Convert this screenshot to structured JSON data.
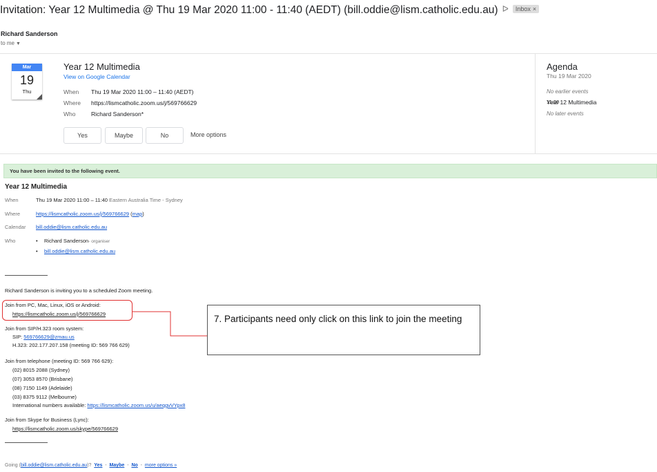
{
  "header": {
    "subject": "Invitation: Year 12 Multimedia @ Thu 19 Mar 2020 11:00 - 11:40 (AEDT) (bill.oddie@lism.catholic.edu.au)",
    "importance_icon": "important-marker-icon",
    "label_badge": "Inbox",
    "label_remove": "×",
    "sender": "Richard Sanderson",
    "to": "to me"
  },
  "card": {
    "calendar_icon": {
      "month": "Mar",
      "day": "19",
      "weekday": "Thu"
    },
    "title": "Year 12 Multimedia",
    "gcal_link": "View on Google Calendar",
    "when_label": "When",
    "when_value": "Thu 19 Mar 2020 11:00 – 11:40 (AEDT)",
    "where_label": "Where",
    "where_value": "https://lismcatholic.zoom.us/j/569766629",
    "who_label": "Who",
    "who_value": "Richard Sanderson*",
    "rsvp": {
      "yes": "Yes",
      "maybe": "Maybe",
      "no": "No",
      "more": "More options"
    }
  },
  "agenda": {
    "title": "Agenda",
    "date": "Thu 19 Mar 2020",
    "no_earlier": "No earlier events",
    "item_time": "11:00",
    "item_title": "Year 12 Multimedia",
    "no_later": "No later events"
  },
  "body": {
    "banner": "You have been invited to the following event.",
    "title": "Year 12 Multimedia",
    "when_label": "When",
    "when_value": "Thu 19 Mar 2020 11:00 – 11:40",
    "when_tz": "Eastern Australia Time - Sydney",
    "where_label": "Where",
    "where_link": "https://lismcatholic.zoom.us/j/569766629",
    "map_open": "(",
    "map_link": "map",
    "map_close": ")",
    "calendar_label": "Calendar",
    "calendar_link": "bill.oddie@lism.catholic.edu.au",
    "who_label": "Who",
    "who": [
      {
        "name": "Richard Sanderson",
        "role": "- organiser"
      },
      {
        "name": "bill.oddie@lism.catholic.edu.au",
        "role": ""
      }
    ],
    "intro": "Richard Sanderson is inviting you to a scheduled Zoom meeting.",
    "pc_heading": "Join from PC, Mac, Linux, iOS or Android:",
    "pc_link": "https://lismcatholic.zoom.us/j/569766629",
    "sip_heading": "Join from SIP/H.323 room system:",
    "sip_label": "SIP:",
    "sip_link": "569766629@zmau.us",
    "h323": "H.323: 202.177.207.158 (meeting ID: 569 766 629)",
    "phone_heading": "Join from telephone (meeting ID: 569 766 629):",
    "phones": [
      "(02) 8015 2088 (Sydney)",
      "(07) 3053 8570 (Brisbane)",
      "(08) 7150 1149 (Adelaide)",
      "(03) 8375 9112 (Melbourne)"
    ],
    "intl_label": "International numbers available:",
    "intl_link": "https://lismcatholic.zoom.us/u/aeqgvVYpx8",
    "skype_heading": "Join from Skype for Business (Lync):",
    "skype_link": "https://lismcatholic.zoom.us/skype/569766629",
    "going_prefix": "Going (",
    "going_email": "bill.oddie@lism.catholic.edu.au",
    "going_suffix": ")?",
    "going_yes": "Yes",
    "going_maybe": "Maybe",
    "going_no": "No",
    "going_more": "more options »",
    "going_sep": "-"
  },
  "annotation": {
    "callout_text": "7. Participants need only click on this link to join the meeting",
    "highlight_color": "#e03030"
  },
  "colors": {
    "banner_bg": "#d9f0d9",
    "link": "#1155cc",
    "calendar_blue": "#4285f4"
  }
}
